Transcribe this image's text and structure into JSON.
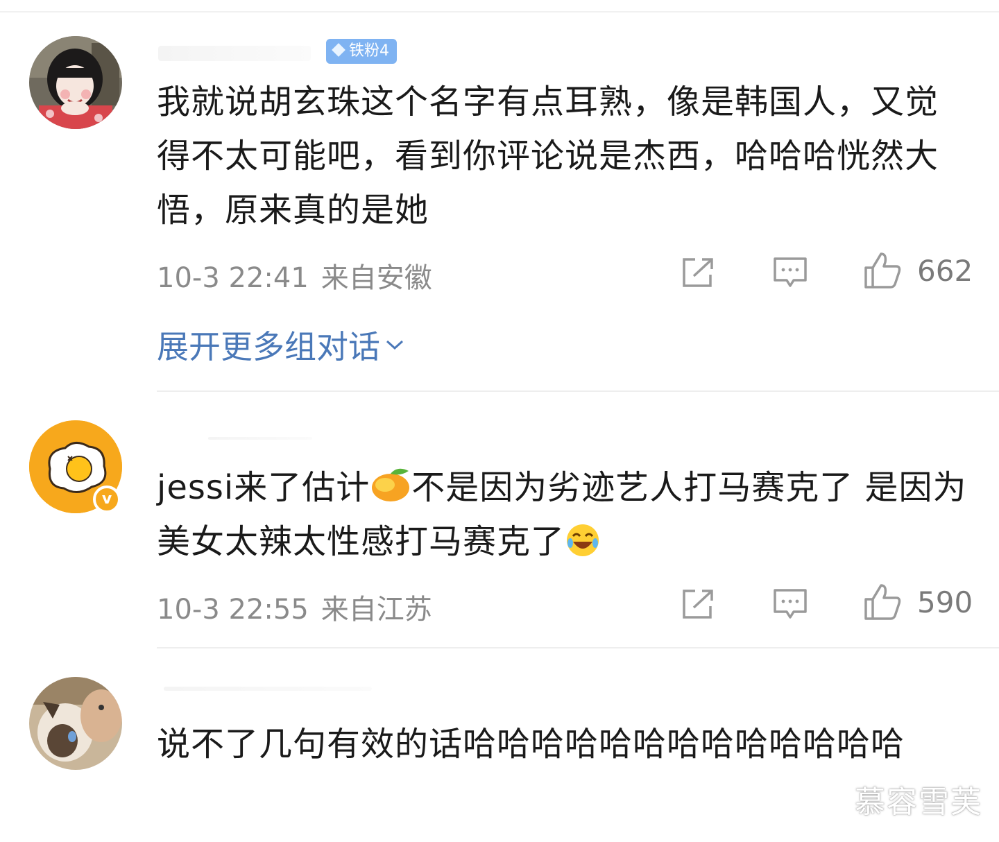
{
  "comments": [
    {
      "badge": "铁粉4",
      "text": "我就说胡玄珠这个名字有点耳熟，像是韩国人，又觉得不太可能吧，看到你评论说是杰西，哈哈哈恍然大悟，原来真的是她",
      "time": "10-3 22:41",
      "location": "来自安徽",
      "likes": "662",
      "expand_label": "展开更多组对话"
    },
    {
      "text_part1": "jessi来了估计",
      "emoji1": "mango-emoji",
      "text_part2": "不是因为劣迹艺人打马赛克了 是因为美女太辣太性感打马赛克了",
      "emoji2": "laugh-cry-emoji",
      "time": "10-3 22:55",
      "location": "来自江苏",
      "likes": "590"
    },
    {
      "text": "说不了几句有效的话哈哈哈哈哈哈哈哈哈哈哈哈哈"
    }
  ],
  "icons": {
    "share": "share-icon",
    "reply": "comment-icon",
    "like": "thumbs-up-icon",
    "expand": "chevron-down-icon"
  },
  "colors": {
    "link": "#4a78b8",
    "meta": "#8a8a8a",
    "badge": "#7fb3f2",
    "verified": "#f7a81c"
  },
  "watermark": "慕容雪芙"
}
